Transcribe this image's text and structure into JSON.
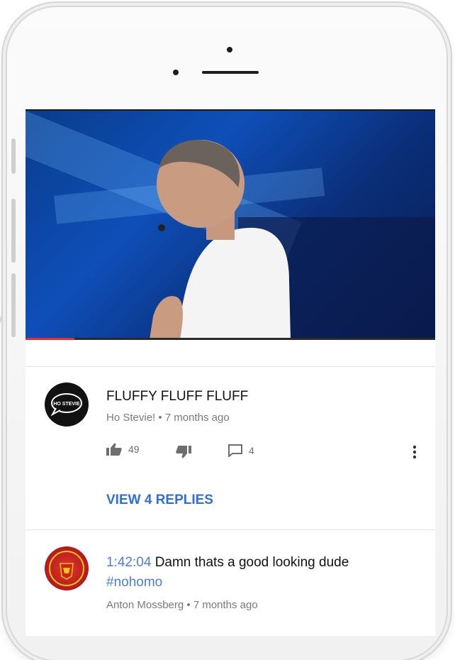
{
  "video": {
    "progress_fraction": 0.12
  },
  "comments": [
    {
      "author_name": "FLUFFY FLUFF FLUFF",
      "subtitle": "Ho Stevie! • 7 months ago",
      "likes": "49",
      "reply_count": "4",
      "view_replies_label": "VIEW 4 REPLIES",
      "avatar_text": "HO STEVIE"
    },
    {
      "timestamp": "1:42:04",
      "text": "Damn thats a good looking dude",
      "hashtag": "#nohomo",
      "subtitle": "Anton Mossberg • 7 months ago"
    }
  ],
  "icons": [
    "thumbs-up-icon",
    "thumbs-down-icon",
    "reply-icon",
    "more-vert-icon"
  ],
  "colors": {
    "link": "#2f6fd6",
    "progress": "#e52d27"
  }
}
